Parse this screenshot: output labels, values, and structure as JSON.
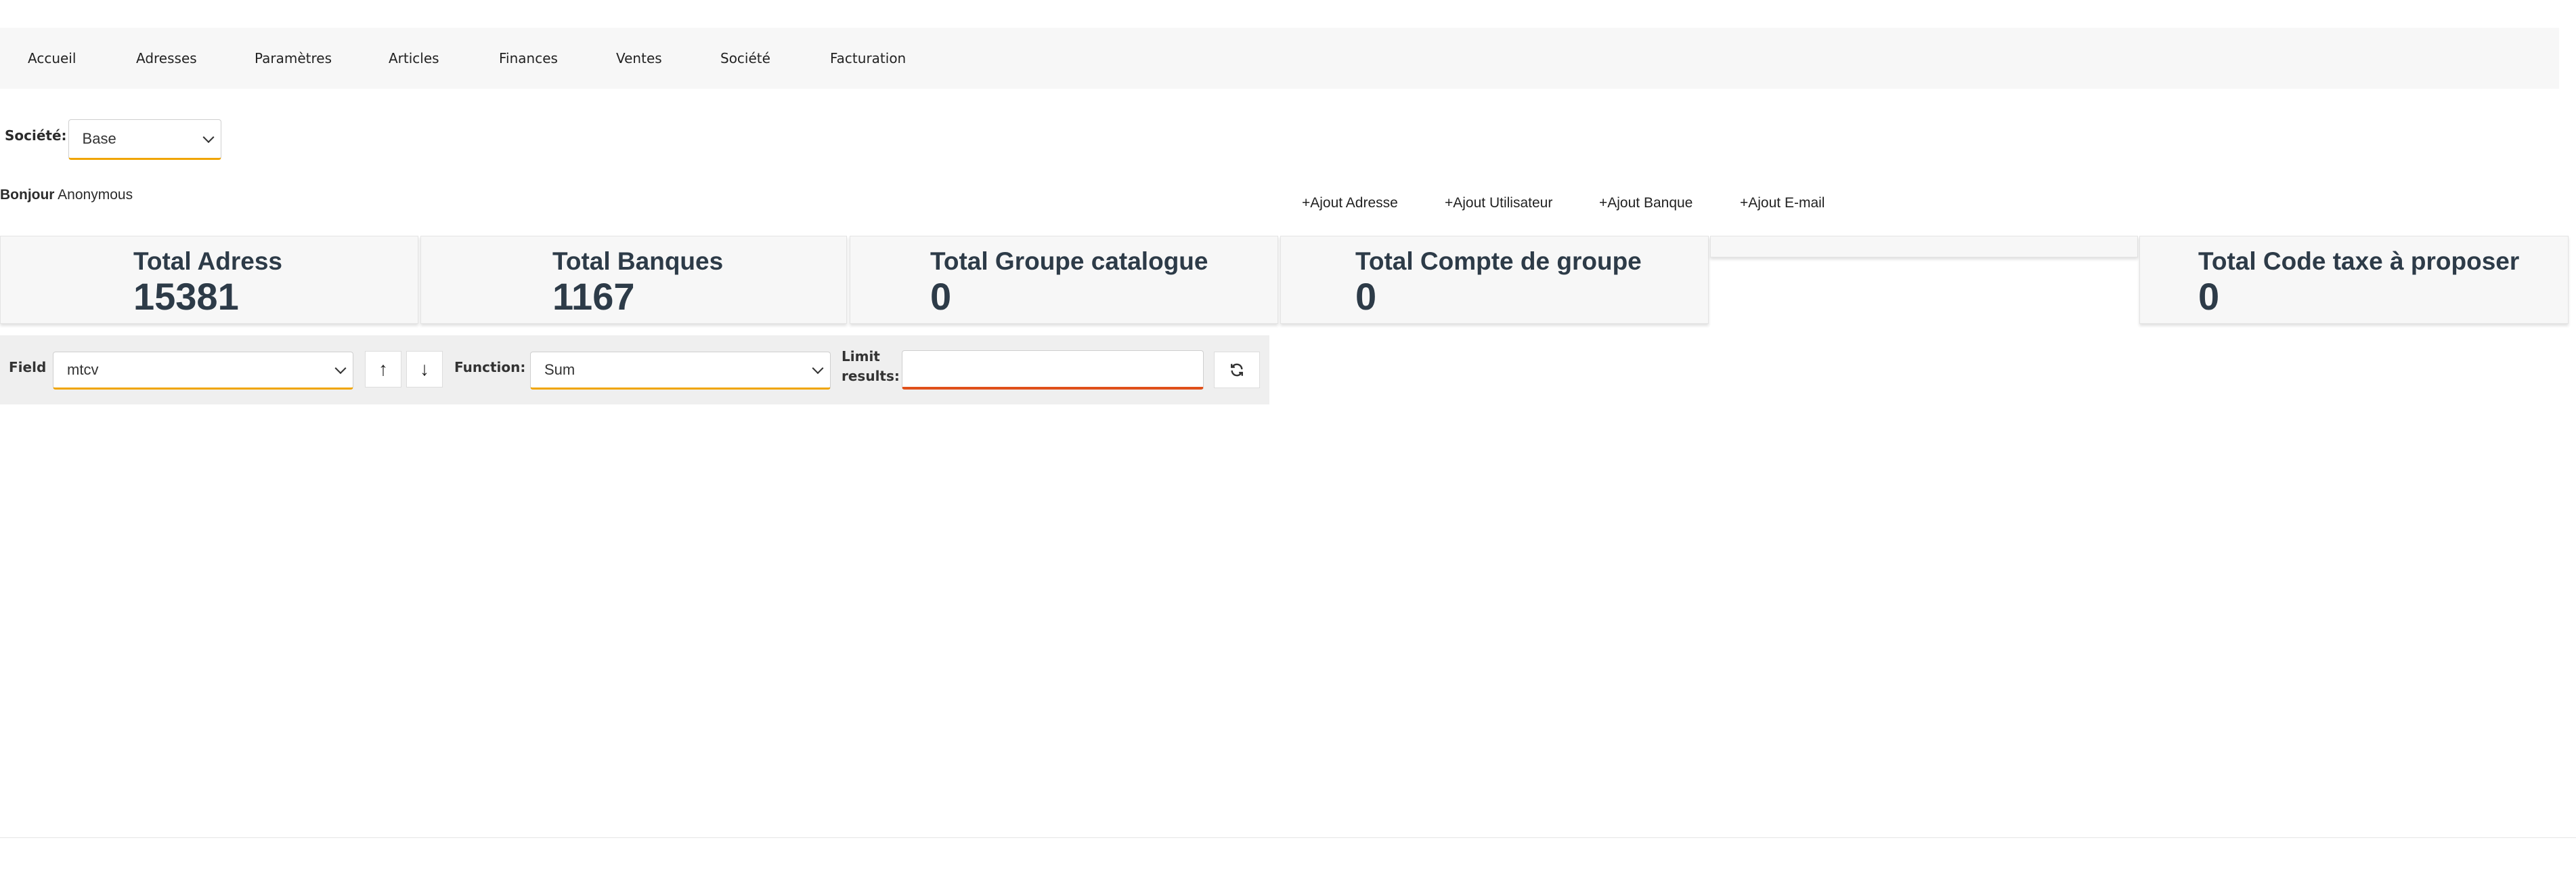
{
  "nav": {
    "items": [
      "Accueil",
      "Adresses",
      "Paramètres",
      "Articles",
      "Finances",
      "Ventes",
      "Société",
      "Facturation"
    ]
  },
  "company": {
    "label": "Société:",
    "selected": "Base"
  },
  "greeting": {
    "hello": "Bonjour",
    "user": "Anonymous"
  },
  "quick_actions": [
    "+Ajout Adresse",
    "+Ajout Utilisateur",
    "+Ajout Banque",
    "+Ajout E-mail"
  ],
  "stats": [
    {
      "title": "Total Adress",
      "value": "15381"
    },
    {
      "title": "Total Banques",
      "value": "1167"
    },
    {
      "title": "Total Groupe catalogue",
      "value": "0"
    },
    {
      "title": "Total Compte de groupe",
      "value": "0"
    },
    {
      "title": "",
      "value": ""
    },
    {
      "title": "Total Code taxe à proposer",
      "value": "0"
    }
  ],
  "toolbar": {
    "field_label": "Field",
    "field_value": "mtcv",
    "sort_asc": "↑",
    "sort_desc": "↓",
    "function_label": "Function:",
    "function_value": "Sum",
    "limit_label_1": "Limit",
    "limit_label_2": "results:",
    "limit_value": "",
    "refresh_icon": "refresh-icon"
  },
  "colors": {
    "select_underline": "#f0a500",
    "input_underline": "#e0501a",
    "card_text": "#2d3b48"
  }
}
